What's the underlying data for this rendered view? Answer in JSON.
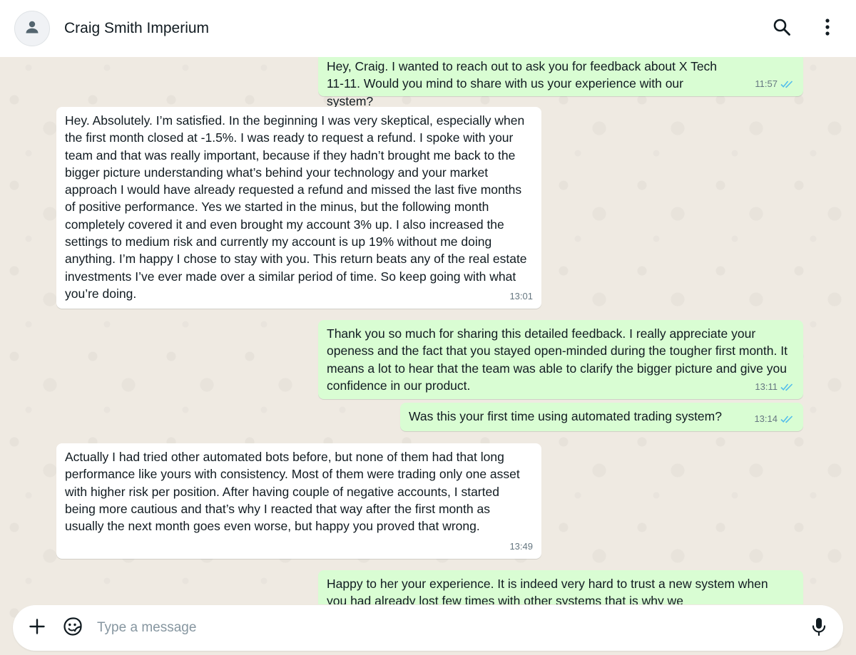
{
  "header": {
    "contact_name": "Craig Smith Imperium"
  },
  "messages": [
    {
      "direction": "out",
      "text": "Hey, Craig. I wanted to reach out to ask you for feedback about X Tech 11-11. Would you mind to share with us your experience with our system?",
      "time": "11:57",
      "status": "read"
    },
    {
      "direction": "in",
      "text": "Hey. Absolutely. I’m satisfied. In the beginning I was very skeptical, especially when the first month closed at -1.5%. I was ready to request a refund. I spoke with your team and that was really important, because if they hadn’t brought me back to the bigger picture understanding what’s behind your technology and your market approach I would have already requested a refund and missed the last five months of positive performance. Yes we started in the minus, but the following month completely covered it and even brought my account 3% up. I also increased the settings to medium risk and currently my account is up 19% without me doing anything. I’m happy I chose to stay with you. This return beats any of the real estate investments I’ve ever made over a similar period of time. So keep going with what you’re doing.",
      "time": "13:01"
    },
    {
      "direction": "out",
      "text": "Thank you so much for sharing this detailed feedback. I really appreciate your openess and the fact that you stayed open-minded during the tougher first month. It means a lot to hear that the team was able to clarify the bigger picture and give you confidence in our product.",
      "time": "13:11",
      "status": "read"
    },
    {
      "direction": "out",
      "text": "Was this your first time using automated trading system?",
      "time": "13:14",
      "status": "read"
    },
    {
      "direction": "in",
      "text": "Actually I had tried other automated bots before, but none of them had that long performance like yours with consistency. Most of them were trading only one asset with higher risk per position. After having couple of negative accounts, I started being more cautious and that’s why I reacted that way after the first month as usually the next month goes even worse, but happy you proved that wrong.",
      "time": "13:49"
    },
    {
      "direction": "out",
      "text": "Happy to her your experience. It is indeed very hard to trust a new system when you had already lost few times with other systems that is why we",
      "time": "",
      "status": ""
    }
  ],
  "composer": {
    "placeholder": "Type a message"
  },
  "icons": {
    "avatar": "person-icon",
    "search": "search-icon",
    "menu": "more-vertical-icon",
    "attach": "plus-icon",
    "sticker": "sticker-icon",
    "mic": "microphone-icon"
  },
  "colors": {
    "outgoing_bubble": "#d9fdd3",
    "incoming_bubble": "#ffffff",
    "read_ticks": "#53bdeb",
    "chat_background": "#efeae2"
  }
}
